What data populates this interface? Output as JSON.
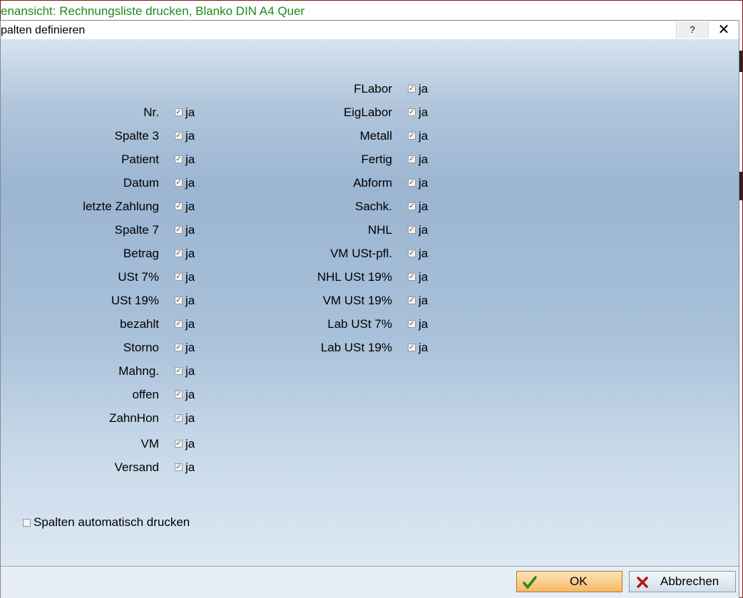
{
  "background_window": {
    "title": "enansicht: Rechnungsliste drucken, Blanko DIN A4 Quer"
  },
  "dialog": {
    "title": "palten definieren",
    "help_label": "?",
    "close_label": "✕"
  },
  "left_columns": [
    {
      "label": "Nr.",
      "value": "ja",
      "checked": true
    },
    {
      "label": "Spalte 3",
      "value": "ja",
      "checked": true
    },
    {
      "label": "Patient",
      "value": "ja",
      "checked": true
    },
    {
      "label": "Datum",
      "value": "ja",
      "checked": true
    },
    {
      "label": "letzte Zahlung",
      "value": "ja",
      "checked": true
    },
    {
      "label": "Spalte 7",
      "value": "ja",
      "checked": true
    },
    {
      "label": "Betrag",
      "value": "ja",
      "checked": true
    },
    {
      "label": "USt 7%",
      "value": "ja",
      "checked": true
    },
    {
      "label": "USt 19%",
      "value": "ja",
      "checked": true
    },
    {
      "label": "bezahlt",
      "value": "ja",
      "checked": true
    },
    {
      "label": "Storno",
      "value": "ja",
      "checked": true
    },
    {
      "label": "Mahng.",
      "value": "ja",
      "checked": true
    },
    {
      "label": "offen",
      "value": "ja",
      "checked": true
    },
    {
      "label": "ZahnHon",
      "value": "ja",
      "checked": true
    },
    {
      "label": "VM",
      "value": "ja",
      "checked": true
    },
    {
      "label": "Versand",
      "value": "ja",
      "checked": true
    }
  ],
  "right_columns": [
    {
      "label": "FLabor",
      "value": "ja",
      "checked": true
    },
    {
      "label": "EigLabor",
      "value": "ja",
      "checked": true
    },
    {
      "label": "Metall",
      "value": "ja",
      "checked": true
    },
    {
      "label": "Fertig",
      "value": "ja",
      "checked": true
    },
    {
      "label": "Abform",
      "value": "ja",
      "checked": true
    },
    {
      "label": "Sachk.",
      "value": "ja",
      "checked": true
    },
    {
      "label": "NHL",
      "value": "ja",
      "checked": true
    },
    {
      "label": "VM USt-pfl.",
      "value": "ja",
      "checked": true
    },
    {
      "label": "NHL USt 19%",
      "value": "ja",
      "checked": true
    },
    {
      "label": "VM USt 19%",
      "value": "ja",
      "checked": true
    },
    {
      "label": "Lab USt 7%",
      "value": "ja",
      "checked": true
    },
    {
      "label": "Lab USt 19%",
      "value": "ja",
      "checked": true
    }
  ],
  "auto_print": {
    "label": "Spalten automatisch drucken",
    "checked": false
  },
  "buttons": {
    "ok_label": "OK",
    "cancel_label": "Abbrechen",
    "ok_icon": "check-icon",
    "cancel_icon": "x-mark-icon"
  },
  "colors": {
    "bg_title_text": "#1b8a1b",
    "ok_check": "#1f8a1f",
    "cancel_x": "#b01818"
  }
}
